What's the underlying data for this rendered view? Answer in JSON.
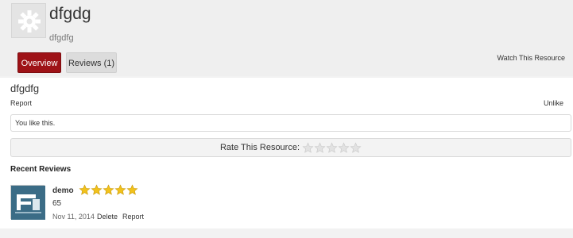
{
  "resource": {
    "title": "dfgdg",
    "tagline": "dfgdfg",
    "icon": "gear-icon"
  },
  "tabs": [
    {
      "label": "Overview",
      "active": true
    },
    {
      "label": "Reviews (1)",
      "active": false
    }
  ],
  "watch_label": "Watch This Resource",
  "overview": {
    "title": "dfgdfg",
    "report_label": "Report",
    "unlike_label": "Unlike",
    "like_text": "You like this."
  },
  "rating": {
    "label": "Rate This Resource:",
    "max": 5,
    "value": 0
  },
  "reviews_section": {
    "heading": "Recent Reviews",
    "items": [
      {
        "user": "demo",
        "rating": 5,
        "text": "65",
        "date": "Nov 11, 2014",
        "delete_label": "Delete",
        "report_label": "Report"
      }
    ]
  },
  "colors": {
    "accent": "#9e1217",
    "star_fill": "#f2c21b",
    "star_empty": "#e2e2e2"
  }
}
